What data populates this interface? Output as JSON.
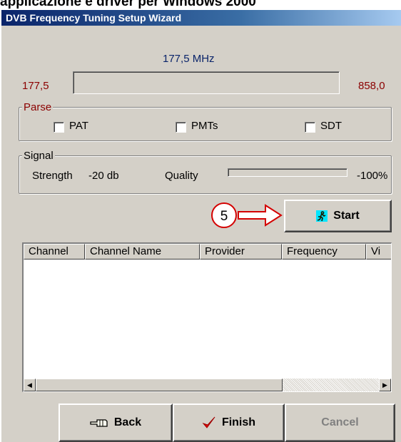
{
  "caption": "applicazione e driver per Windows 2000",
  "window": {
    "title": "DVB Frequency Tuning Setup Wizard"
  },
  "frequency": {
    "current": "177,5 MHz",
    "min": "177,5",
    "max": "858,0",
    "progress": 0
  },
  "parse": {
    "label": "Parse",
    "options": [
      {
        "label": "PAT",
        "checked": false
      },
      {
        "label": "PMTs",
        "checked": false
      },
      {
        "label": "SDT",
        "checked": false
      }
    ]
  },
  "signal": {
    "label": "Signal",
    "strength_label": "Strength",
    "strength_value": "-20 db",
    "quality_label": "Quality",
    "quality_value": "-100%",
    "quality_level": 0
  },
  "annotation": {
    "number": "5",
    "color": "#d40000"
  },
  "start_button": {
    "label": "Start",
    "icon": "running-man-icon"
  },
  "channel_list": {
    "columns": [
      "Channel",
      "Channel Name",
      "Provider",
      "Frequency",
      "Vi"
    ],
    "rows": []
  },
  "footer": {
    "back_label": "Back",
    "back_icon": "hand-pointing-left-icon",
    "finish_label": "Finish",
    "finish_icon": "checkmark-icon",
    "cancel_label": "Cancel"
  },
  "colors": {
    "title_bar": "#0a246a",
    "window_face": "#d4d0c8",
    "limit_text": "#8b0000",
    "freq_text": "#0a246a"
  }
}
